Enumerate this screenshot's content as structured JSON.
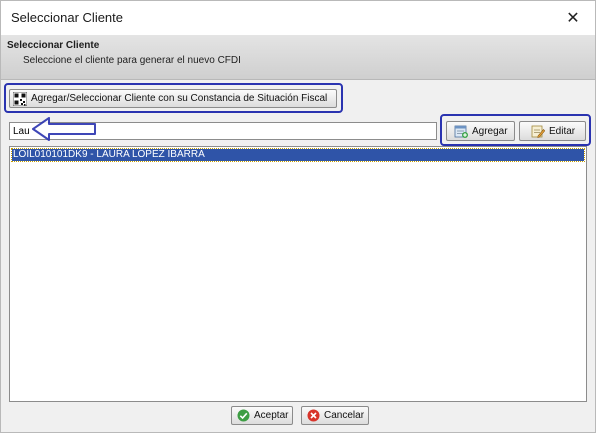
{
  "window": {
    "title": "Seleccionar Cliente",
    "close_glyph": "✕"
  },
  "header": {
    "title": "Seleccionar Cliente",
    "subtitle": "Seleccione el cliente para generar el nuevo CFDI"
  },
  "toolbar": {
    "qr_button_label": "Agregar/Seleccionar Cliente con su Constancia de Situación Fiscal",
    "add_label": "Agregar",
    "edit_label": "Editar"
  },
  "search": {
    "value": "Lau"
  },
  "clients": [
    {
      "label": "LOIL010101DK9 - LAURA LOPEZ IBARRA",
      "selected": true
    }
  ],
  "footer": {
    "accept_label": "Aceptar",
    "cancel_label": "Cancelar"
  },
  "colors": {
    "highlight_border": "#2a33b0",
    "selection_bg": "#2f54a8"
  },
  "icons": {
    "qr_button": "qr-code-icon",
    "add": "add-document-icon",
    "edit": "edit-document-icon",
    "accept": "check-circle-icon",
    "cancel": "cancel-circle-icon",
    "annotation": "arrow-left-icon"
  }
}
